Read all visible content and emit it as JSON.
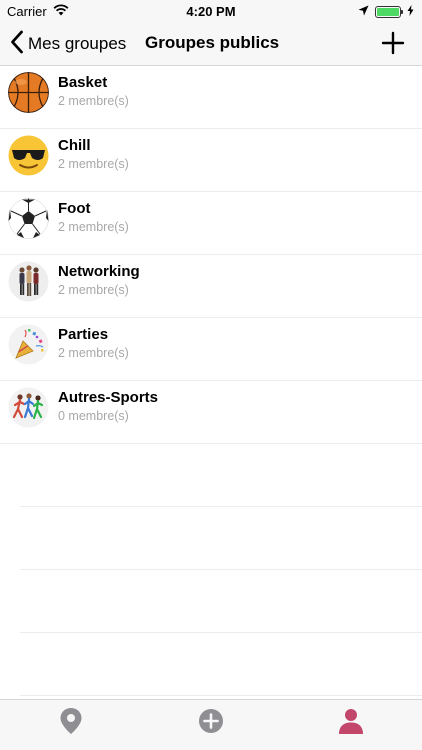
{
  "status_bar": {
    "carrier": "Carrier",
    "time": "4:20 PM",
    "battery_level": 1.0,
    "battery_color": "#4cd964"
  },
  "nav": {
    "back_label": "Mes groupes",
    "title": "Groupes publics",
    "add_icon": "plus-icon"
  },
  "groups": [
    {
      "name": "Basket",
      "members": "2 membre(s)",
      "icon": "basketball-icon"
    },
    {
      "name": "Chill",
      "members": "2 membre(s)",
      "icon": "sunglasses-emoji-icon"
    },
    {
      "name": "Foot",
      "members": "2 membre(s)",
      "icon": "soccer-ball-icon"
    },
    {
      "name": "Networking",
      "members": "2 membre(s)",
      "icon": "people-standing-icon"
    },
    {
      "name": "Parties",
      "members": "2 membre(s)",
      "icon": "party-popper-icon"
    },
    {
      "name": "Autres-Sports",
      "members": "0 membre(s)",
      "icon": "runners-icon"
    }
  ],
  "tab_bar": {
    "tabs": [
      {
        "icon": "location-pin-icon",
        "color": "#8e8e93",
        "active": false
      },
      {
        "icon": "add-circle-icon",
        "color": "#8e8e93",
        "active": false
      },
      {
        "icon": "profile-icon",
        "color": "#c2476b",
        "active": true
      }
    ]
  }
}
